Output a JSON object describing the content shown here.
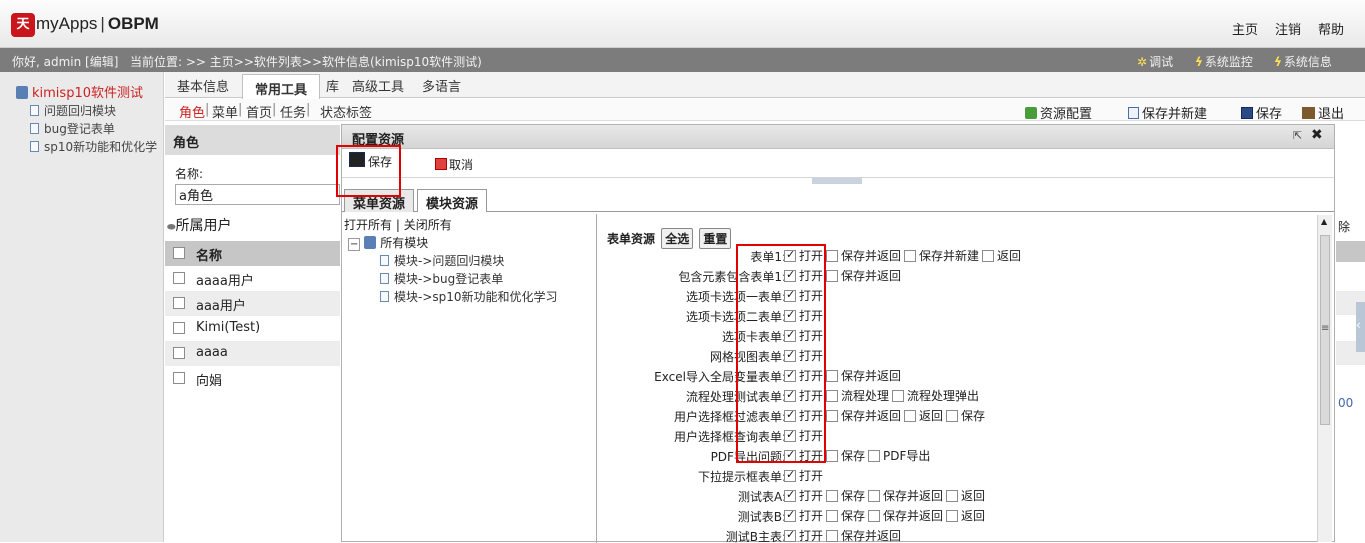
{
  "app": {
    "logo_mark": "天",
    "logo_name": "myApps",
    "logo_product": "OBPM",
    "top_links": [
      "主页",
      "注销",
      "帮助"
    ]
  },
  "status": {
    "greeting": "你好, admin [编辑]",
    "location": "当前位置: >> 主页>>软件列表>>软件信息(kimisp10软件测试)",
    "tools": [
      "调试",
      "系统监控",
      "系统信息"
    ]
  },
  "sidebar": {
    "root": "kimisp10软件测试",
    "items": [
      "问题回归模块",
      "bug登记表单",
      "sp10新功能和优化学"
    ]
  },
  "tabs": [
    "基本信息",
    "常用工具",
    "库",
    "高级工具",
    "多语言"
  ],
  "subtabs": [
    "角色",
    "菜单",
    "首页",
    "任务",
    "状态标签"
  ],
  "toolbar": {
    "resource_config": "资源配置",
    "save_new": "保存并新建",
    "save": "保存",
    "exit": "退出"
  },
  "role_panel": {
    "title": "角色",
    "name_label": "名称:",
    "name_value": "a角色",
    "users_title": "所属用户",
    "col_name": "名称",
    "users": [
      "aaaa用户",
      "aaa用户",
      "Kimi(Test)",
      "aaaa",
      "向娟"
    ]
  },
  "dialog": {
    "title": "配置资源",
    "save": "保存",
    "cancel": "取消",
    "tabs": [
      "菜单资源",
      "模块资源"
    ],
    "expand_all": "打开所有",
    "collapse_all": "关闭所有",
    "tree_root": "所有模块",
    "modules": [
      "模块->问题回归模块",
      "模块->bug登记表单",
      "模块->sp10新功能和优化学习"
    ],
    "form_title": "表单资源",
    "select_all": "全选",
    "reset": "重置",
    "forms": [
      {
        "label": "表单1:",
        "ops": [
          [
            "打开",
            true
          ],
          [
            "保存并返回",
            false
          ],
          [
            "保存并新建",
            false
          ],
          [
            "返回",
            false
          ]
        ]
      },
      {
        "label": "包含元素包含表单1:",
        "ops": [
          [
            "打开",
            true
          ],
          [
            "保存并返回",
            false
          ]
        ]
      },
      {
        "label": "选项卡选项一表单:",
        "ops": [
          [
            "打开",
            true
          ]
        ]
      },
      {
        "label": "选项卡选项二表单:",
        "ops": [
          [
            "打开",
            true
          ]
        ]
      },
      {
        "label": "选项卡表单:",
        "ops": [
          [
            "打开",
            true
          ]
        ]
      },
      {
        "label": "网格视图表单:",
        "ops": [
          [
            "打开",
            true
          ]
        ]
      },
      {
        "label": "Excel导入全局变量表单:",
        "ops": [
          [
            "打开",
            true
          ],
          [
            "保存并返回",
            false
          ]
        ]
      },
      {
        "label": "流程处理测试表单:",
        "ops": [
          [
            "打开",
            true
          ],
          [
            "流程处理",
            false
          ],
          [
            "流程处理弹出",
            false
          ]
        ]
      },
      {
        "label": "用户选择框过滤表单:",
        "ops": [
          [
            "打开",
            true
          ],
          [
            "保存并返回",
            false
          ],
          [
            "返回",
            false
          ],
          [
            "保存",
            false
          ]
        ]
      },
      {
        "label": "用户选择框查询表单:",
        "ops": [
          [
            "打开",
            true
          ]
        ]
      },
      {
        "label": "PDF导出问题:",
        "ops": [
          [
            "打开",
            true
          ],
          [
            "保存",
            false
          ],
          [
            "PDF导出",
            false
          ]
        ]
      },
      {
        "label": "下拉提示框表单:",
        "ops": [
          [
            "打开",
            true
          ]
        ]
      },
      {
        "label": "测试表A:",
        "ops": [
          [
            "打开",
            true
          ],
          [
            "保存",
            false
          ],
          [
            "保存并返回",
            false
          ],
          [
            "返回",
            false
          ]
        ]
      },
      {
        "label": "测试表B:",
        "ops": [
          [
            "打开",
            true
          ],
          [
            "保存",
            false
          ],
          [
            "保存并返回",
            false
          ],
          [
            "返回",
            false
          ]
        ]
      },
      {
        "label": "测试B主表:",
        "ops": [
          [
            "打开",
            true
          ],
          [
            "保存并返回",
            false
          ]
        ]
      }
    ]
  },
  "right_edge": {
    "top_text": "除",
    "bottom_text": "00"
  },
  "colors": {
    "accent_red": "#e00000",
    "status_bar": "#7c7c7c"
  }
}
